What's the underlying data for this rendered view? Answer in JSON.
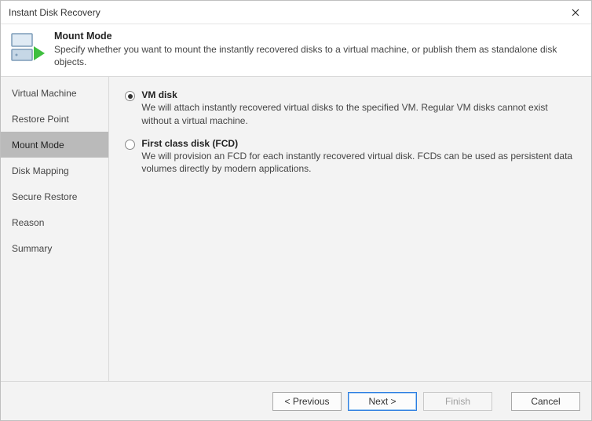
{
  "window": {
    "title": "Instant Disk Recovery"
  },
  "header": {
    "title": "Mount Mode",
    "subtitle": "Specify whether you want to mount the instantly recovered disks to a virtual machine, or publish them as standalone disk objects."
  },
  "sidebar": {
    "items": [
      {
        "label": "Virtual Machine",
        "active": false
      },
      {
        "label": "Restore Point",
        "active": false
      },
      {
        "label": "Mount Mode",
        "active": true
      },
      {
        "label": "Disk Mapping",
        "active": false
      },
      {
        "label": "Secure Restore",
        "active": false
      },
      {
        "label": "Reason",
        "active": false
      },
      {
        "label": "Summary",
        "active": false
      }
    ]
  },
  "options": [
    {
      "selected": true,
      "title": "VM disk",
      "description": "We will attach instantly recovered virtual disks to the specified VM. Regular VM disks cannot exist without a virtual machine."
    },
    {
      "selected": false,
      "title": "First class disk (FCD)",
      "description": "We will provision an FCD for each instantly recovered virtual disk. FCDs can be used as persistent data volumes directly by modern applications."
    }
  ],
  "footer": {
    "previous": "< Previous",
    "next": "Next >",
    "finish": "Finish",
    "cancel": "Cancel"
  }
}
